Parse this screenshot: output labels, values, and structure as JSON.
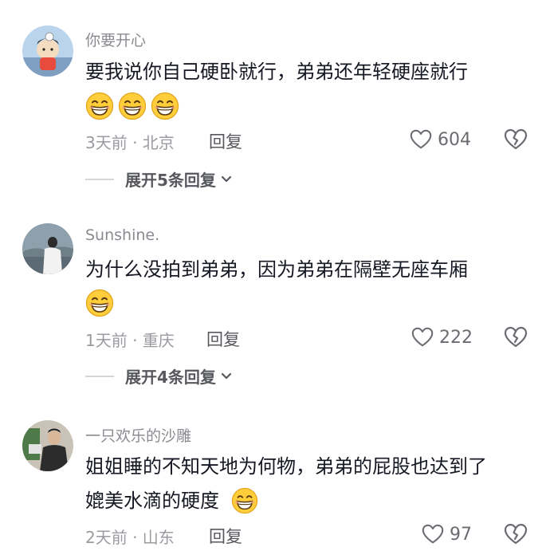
{
  "comments": [
    {
      "username": "你要开心",
      "text": "要我说你自己硬卧就行，弟弟还年轻硬座就行",
      "emojis": [
        "grin-emoji",
        "grin-emoji",
        "grin-emoji"
      ],
      "time_location": "3天前 · 北京",
      "reply_label": "回复",
      "likes": "604",
      "expand_label": "展开5条回复"
    },
    {
      "username": "Sunshine.",
      "text": "为什么没拍到弟弟，因为弟弟在隔壁无座车厢",
      "emojis": [
        "grin-emoji"
      ],
      "time_location": "1天前 · 重庆",
      "reply_label": "回复",
      "likes": "222",
      "expand_label": "展开4条回复"
    },
    {
      "username": "一只欢乐的沙雕",
      "text_line1": "姐姐睡的不知天地为何物，弟弟的屁股也达到了",
      "text_line2": "媲美水滴的硬度",
      "emojis": [
        "grin-emoji"
      ],
      "time_location": "2天前 · 山东",
      "reply_label": "回复",
      "likes": "97"
    }
  ],
  "icons": {
    "like": "heart-outline-icon",
    "dislike": "broken-heart-icon",
    "expand": "chevron-down-icon"
  }
}
